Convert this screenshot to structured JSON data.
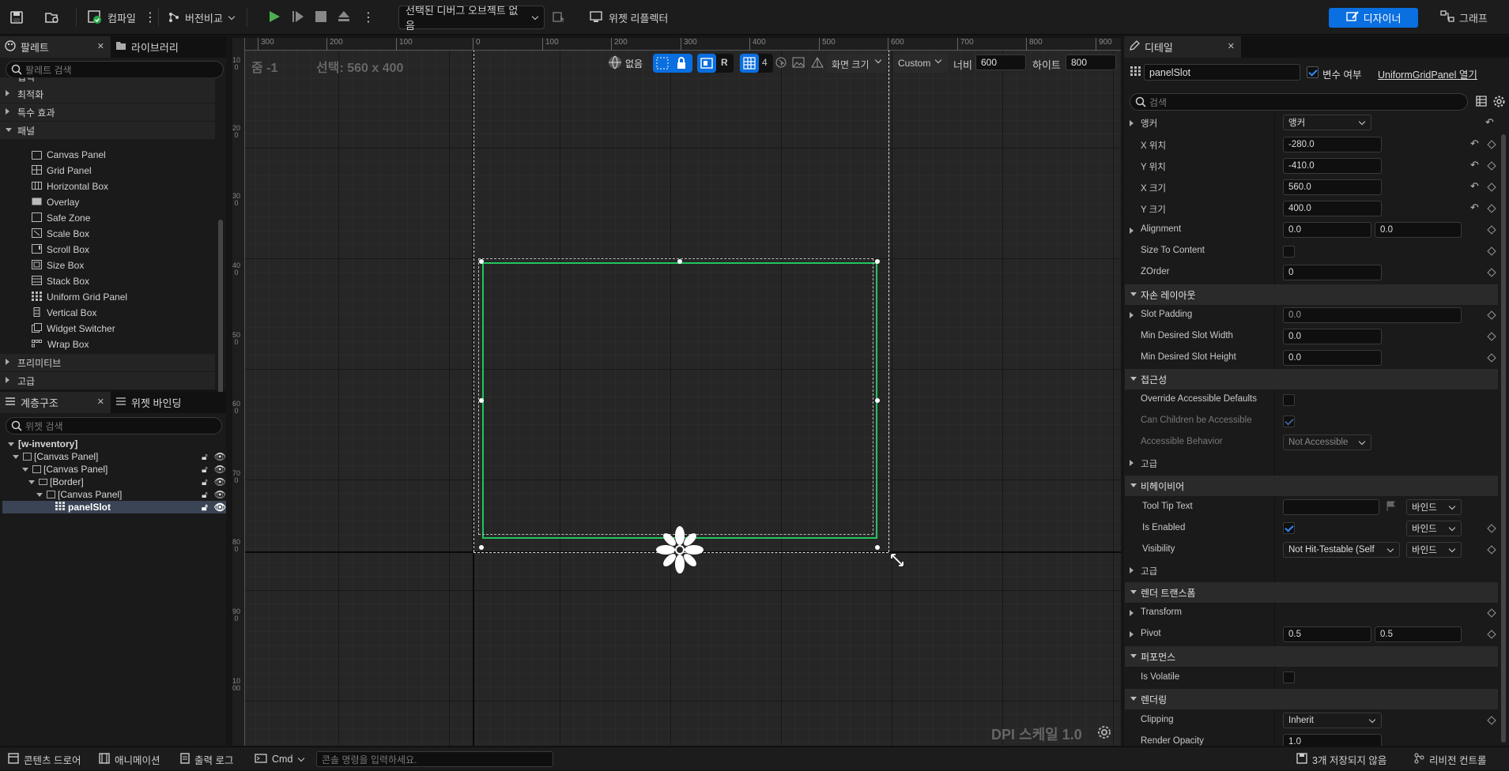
{
  "toolbar": {
    "compile": "컴파일",
    "diff": "버전비교",
    "debug_object": "선택된 디버그 오브젝트 없음",
    "widget_reflector": "위젯 리플렉터",
    "designer": "디자이너",
    "graph": "그래프"
  },
  "palette": {
    "tab_palette": "팔레트",
    "tab_library": "라이브러리",
    "search_placeholder": "팔레트 검색",
    "categories_top": [
      "입력",
      "최적화",
      "특수 효과"
    ],
    "panel_category": "패널",
    "panel_items": [
      "Canvas Panel",
      "Grid Panel",
      "Horizontal Box",
      "Overlay",
      "Safe Zone",
      "Scale Box",
      "Scroll Box",
      "Size Box",
      "Stack Box",
      "Uniform Grid Panel",
      "Vertical Box",
      "Widget Switcher",
      "Wrap Box"
    ],
    "categories_bottom": [
      "프리미티브",
      "고급"
    ]
  },
  "hierarchy": {
    "tab_hierarchy": "계층구조",
    "tab_bindings": "위젯 바인딩",
    "search_placeholder": "위젯 검색",
    "rows": [
      "[w-inventory]",
      "[Canvas Panel]",
      "[Canvas Panel]",
      "[Border]",
      "[Canvas Panel]",
      "panelSlot"
    ]
  },
  "viewport": {
    "zoom": "줌 -1",
    "selection": "선택: 560 x 400",
    "locale": "없음",
    "r_label": "R",
    "grid_count": "4",
    "screen_size": "화면 크기",
    "custom": "Custom",
    "width_label": "너비",
    "width_value": "600",
    "height_label": "하이트",
    "height_value": "800",
    "dpi": "DPI 스케일 1.0",
    "ruler_h": [
      "300",
      "200",
      "100",
      "0",
      "100",
      "200",
      "300",
      "400",
      "500",
      "600",
      "700",
      "800",
      "900"
    ],
    "ruler_v": [
      "100",
      "200",
      "300",
      "400",
      "500",
      "600",
      "700",
      "800",
      "900",
      "1000"
    ]
  },
  "details": {
    "tab": "디테일",
    "name": "panelSlot",
    "is_variable": "변수 여부",
    "open_link": "UniformGridPanel 열기",
    "search_placeholder": "검색",
    "anchor_label": "앵커",
    "anchor_value": "앵커",
    "x_pos_label": "X 위치",
    "x_pos": "-280.0",
    "y_pos_label": "Y 위치",
    "y_pos": "-410.0",
    "x_size_label": "X 크기",
    "x_size": "560.0",
    "y_size_label": "Y 크기",
    "y_size": "400.0",
    "alignment_label": "Alignment",
    "alignment_x": "0.0",
    "alignment_y": "0.0",
    "size_to_content_label": "Size To Content",
    "zorder_label": "ZOrder",
    "zorder": "0",
    "child_layout": "자손 레이아웃",
    "slot_padding_label": "Slot Padding",
    "slot_padding": "0.0",
    "min_w_label": "Min Desired Slot Width",
    "min_w": "0.0",
    "min_h_label": "Min Desired Slot Height",
    "min_h": "0.0",
    "accessibility": "접근성",
    "override_label": "Override Accessible Defaults",
    "children_label": "Can Children be Accessible",
    "behavior_label": "Accessible Behavior",
    "behavior": "Not Accessible",
    "advanced1": "고급",
    "behavior_section": "비헤이비어",
    "tooltip_label": "Tool Tip Text",
    "bind": "바인드",
    "is_enabled_label": "Is Enabled",
    "visibility_label": "Visibility",
    "visibility": "Not Hit-Testable (Self",
    "advanced2": "고급",
    "render_transform": "렌더 트랜스폼",
    "transform_label": "Transform",
    "pivot_label": "Pivot",
    "pivot_x": "0.5",
    "pivot_y": "0.5",
    "performance": "퍼포먼스",
    "volatile_label": "Is Volatile",
    "rendering": "렌더링",
    "clipping_label": "Clipping",
    "clipping": "Inherit",
    "opacity_label": "Render Opacity",
    "opacity": "1.0"
  },
  "statusbar": {
    "content_drawer": "콘텐츠 드로어",
    "animation": "애니메이션",
    "output_log": "출력 로그",
    "cmd": "Cmd",
    "console_placeholder": "콘솔 명령을 입력하세요.",
    "unsaved": "3개 저장되지 않음",
    "revision": "리비전 컨트롤"
  }
}
